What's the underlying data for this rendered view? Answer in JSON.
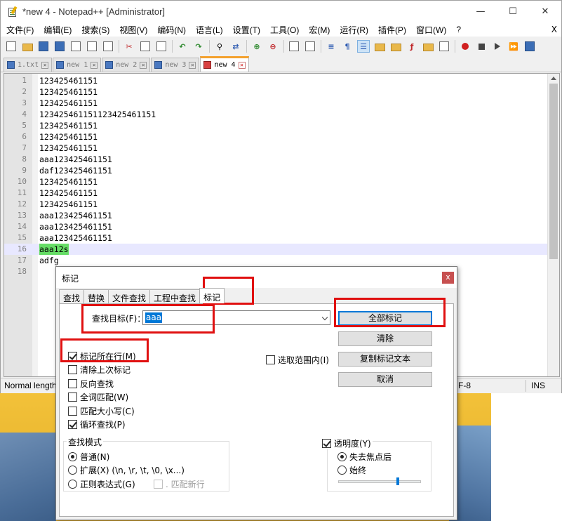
{
  "window": {
    "title": "*new 4 - Notepad++ [Administrator]",
    "controls": {
      "minimize": "—",
      "maximize": "☐",
      "close": "✕"
    }
  },
  "menubar": {
    "items": [
      "文件(F)",
      "编辑(E)",
      "搜索(S)",
      "视图(V)",
      "编码(N)",
      "语言(L)",
      "设置(T)",
      "工具(O)",
      "宏(M)",
      "运行(R)",
      "插件(P)",
      "窗口(W)",
      "?"
    ],
    "close": "X"
  },
  "tabs": [
    {
      "label": "1.txt",
      "active": false
    },
    {
      "label": "new 1",
      "active": false
    },
    {
      "label": "new 2",
      "active": false
    },
    {
      "label": "new 3",
      "active": false
    },
    {
      "label": "new 4",
      "active": true
    }
  ],
  "editor": {
    "lines": [
      {
        "n": "1",
        "text": "123425461151"
      },
      {
        "n": "2",
        "text": "123425461151"
      },
      {
        "n": "3",
        "text": "123425461151"
      },
      {
        "n": "4",
        "text": "123425461151123425461151"
      },
      {
        "n": "5",
        "text": "123425461151"
      },
      {
        "n": "6",
        "text": "123425461151"
      },
      {
        "n": "7",
        "text": "123425461151"
      },
      {
        "n": "8",
        "text": "aaa123425461151"
      },
      {
        "n": "9",
        "text": "daf123425461151"
      },
      {
        "n": "10",
        "text": "123425461151"
      },
      {
        "n": "11",
        "text": "123425461151"
      },
      {
        "n": "12",
        "text": "123425461151"
      },
      {
        "n": "13",
        "text": "aaa123425461151"
      },
      {
        "n": "14",
        "text": "aaa123425461151"
      },
      {
        "n": "15",
        "text": "aaa123425461151"
      },
      {
        "n": "16",
        "text": "aaa12s"
      },
      {
        "n": "17",
        "text": "adfg"
      },
      {
        "n": "18",
        "text": ""
      }
    ],
    "current_line": "16"
  },
  "statusbar": {
    "left": "Normal length",
    "encoding": "F-8",
    "mode": "INS"
  },
  "dialog": {
    "title": "标记",
    "close": "x",
    "tabs": [
      "查找",
      "替换",
      "文件查找",
      "工程中查找",
      "标记"
    ],
    "active_tab": "标记",
    "find_label": "查找目标(F)：",
    "find_value": "aaa",
    "buttons": {
      "mark_all": "全部标记",
      "clear": "清除",
      "copy_marked": "复制标记文本",
      "cancel": "取消"
    },
    "options": {
      "bookmark_line": "标记所在行(M)",
      "purge": "清除上次标记",
      "backward": "反向查找",
      "whole_word": "全词匹配(W)",
      "match_case": "匹配大小写(C)",
      "wrap": "循环查找(P)",
      "in_selection": "选取范围内(I)"
    },
    "search_mode": {
      "title": "查找模式",
      "normal": "普通(N)",
      "extended": "扩展(X) (\\n, \\r, \\t, \\0, \\x...)",
      "regex": "正则表达式(G)",
      "dot_newline": ". 匹配新行"
    },
    "transparency": {
      "title": "透明度(Y)",
      "on_lose_focus": "失去焦点后",
      "always": "始终",
      "level": 0.72
    }
  }
}
